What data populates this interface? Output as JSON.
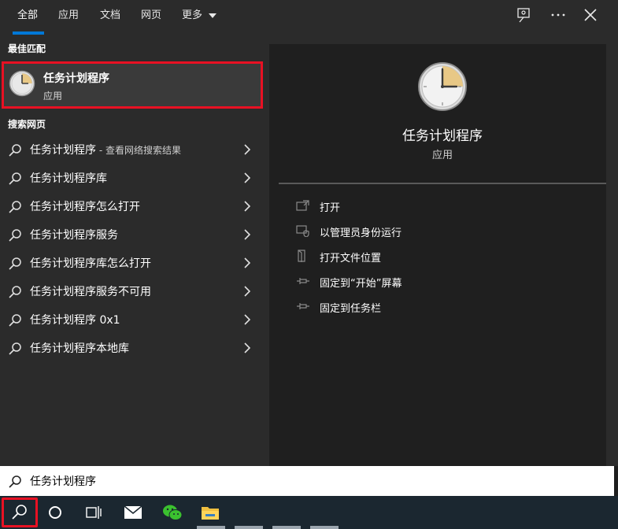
{
  "tabs": [
    "全部",
    "应用",
    "文档",
    "网页",
    "更多"
  ],
  "best_match": {
    "section_label": "最佳匹配",
    "title": "任务计划程序",
    "subtitle": "应用"
  },
  "web_section_label": "搜索网页",
  "web_results": [
    {
      "main": "任务计划程序",
      "sub": " - 查看网络搜索结果"
    },
    {
      "main": "任务计划程序库",
      "sub": ""
    },
    {
      "main": "任务计划程序怎么打开",
      "sub": ""
    },
    {
      "main": "任务计划程序服务",
      "sub": ""
    },
    {
      "main": "任务计划程序库怎么打开",
      "sub": ""
    },
    {
      "main": "任务计划程序服务不可用",
      "sub": ""
    },
    {
      "main": "任务计划程序 0x1",
      "sub": ""
    },
    {
      "main": "任务计划程序本地库",
      "sub": ""
    }
  ],
  "preview": {
    "title": "任务计划程序",
    "subtitle": "应用",
    "actions": [
      "打开",
      "以管理员身份运行",
      "打开文件位置",
      "固定到“开始”屏幕",
      "固定到任务栏"
    ]
  },
  "search": {
    "value": "任务计划程序"
  },
  "colors": {
    "accent": "#0078d7",
    "highlight": "#e81123",
    "panel": "#2b2b2b",
    "preview_bg": "#1f1f1f",
    "taskbar": "#1b2730"
  },
  "icons": {
    "feedback": "feedback-icon",
    "more": "more-options-icon",
    "close": "close-icon",
    "app": "clock-icon",
    "search": "search-icon",
    "chevron": "chevron-right-icon"
  }
}
